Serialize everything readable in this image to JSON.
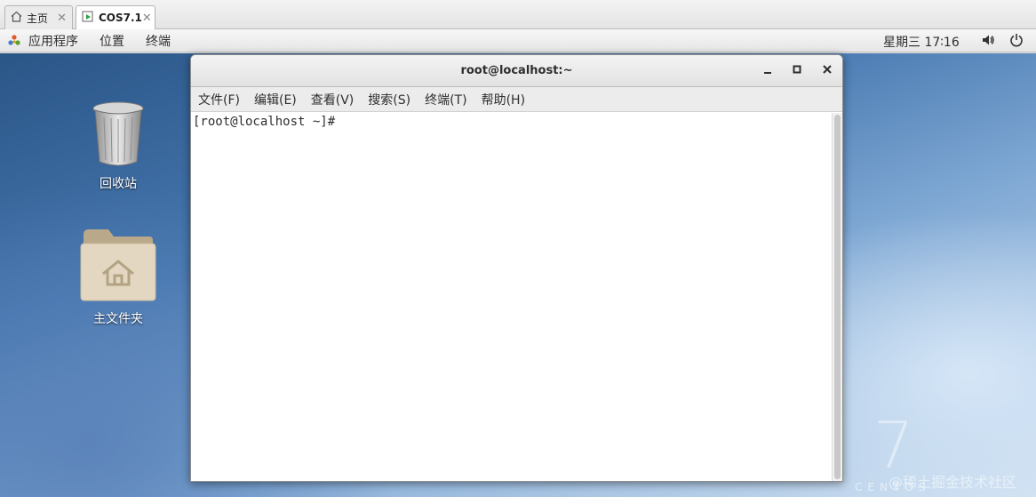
{
  "vm_tabs": [
    {
      "label": "主页",
      "icon": "home-icon",
      "active": false
    },
    {
      "label": "COS7.1",
      "icon": "vm-play-icon",
      "active": true
    }
  ],
  "gnome_bar": {
    "menus": [
      "应用程序",
      "位置",
      "终端"
    ],
    "clock": "星期三 17∶16",
    "icons": [
      "volume-icon",
      "power-icon"
    ]
  },
  "desktop_icons": [
    {
      "label": "回收站",
      "icon": "trash-icon"
    },
    {
      "label": "主文件夹",
      "icon": "home-folder-icon"
    }
  ],
  "terminal": {
    "title": "root@localhost:~",
    "menu": [
      "文件(F)",
      "编辑(E)",
      "查看(V)",
      "搜索(S)",
      "终端(T)",
      "帮助(H)"
    ],
    "prompt": "[root@localhost ~]# "
  },
  "branding": {
    "version_digit": "7",
    "word": "CENTOS",
    "watermark": "@稀土掘金技术社区"
  }
}
